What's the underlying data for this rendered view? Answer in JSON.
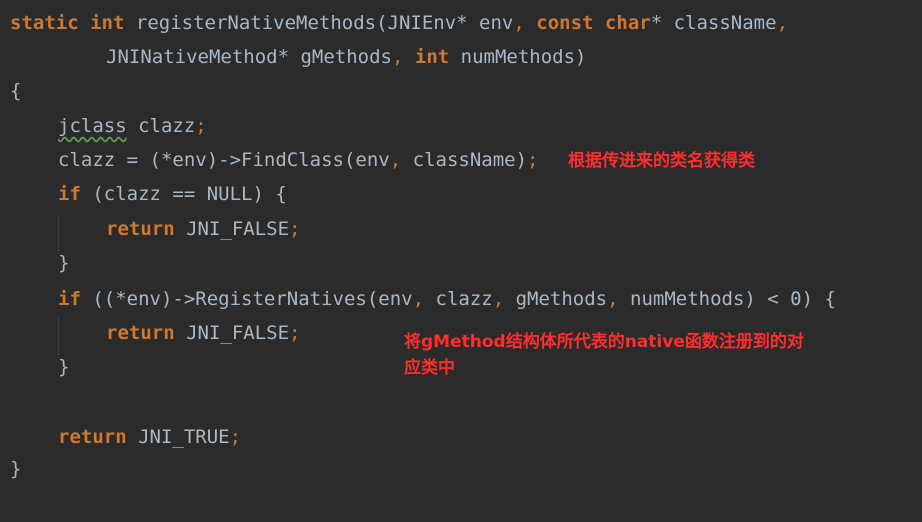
{
  "code": {
    "l1": {
      "kw_static": "static",
      "kw_int": "int",
      "fn": "registerNativeMethods",
      "open_paren": "(",
      "t1": "JNIEnv* env",
      "comma1": ",",
      "kw_const": "const",
      "kw_char": "char",
      "t2": "* className",
      "comma2": ","
    },
    "l2": {
      "t1": "JNINativeMethod* gMethods",
      "comma1": ",",
      "kw_int": "int",
      "t2": "numMethods)"
    },
    "l3": {
      "t": "{"
    },
    "l4": {
      "t1": "jclass",
      "t2": " clazz",
      "semi": ";"
    },
    "l5": {
      "t": "clazz = (*env)->FindClass(env",
      "comma": ",",
      "t2": " className)",
      "semi": ";"
    },
    "l6": {
      "kw": "if",
      "t": " (clazz == NULL) {"
    },
    "l7": {
      "kw": "return",
      "t": " JNI_FALSE",
      "semi": ";"
    },
    "l8": {
      "t": "}"
    },
    "l9": {
      "kw": "if",
      "t1": " ((*env)->RegisterNatives(env",
      "c1": ",",
      "t2": " clazz",
      "c2": ",",
      "t3": " gMethods",
      "c3": ",",
      "t4": " numMethods) < 0) {"
    },
    "l10": {
      "kw": "return",
      "t": " JNI_FALSE",
      "semi": ";"
    },
    "l11": {
      "t": "}"
    },
    "l12": {
      "kw": "return",
      "t": " JNI_TRUE",
      "semi": ";"
    },
    "l13": {
      "t": "}"
    }
  },
  "annotations": {
    "find_class": "根据传进来的类名获得类",
    "register_line1": "将gMethod结构体所代表的native函数注册到的对",
    "register_line2": "应类中"
  },
  "colors": {
    "background": "#2b2b2b",
    "keyword": "#cc7832",
    "text": "#a9b7c6",
    "annotation": "#ff2d2d"
  }
}
